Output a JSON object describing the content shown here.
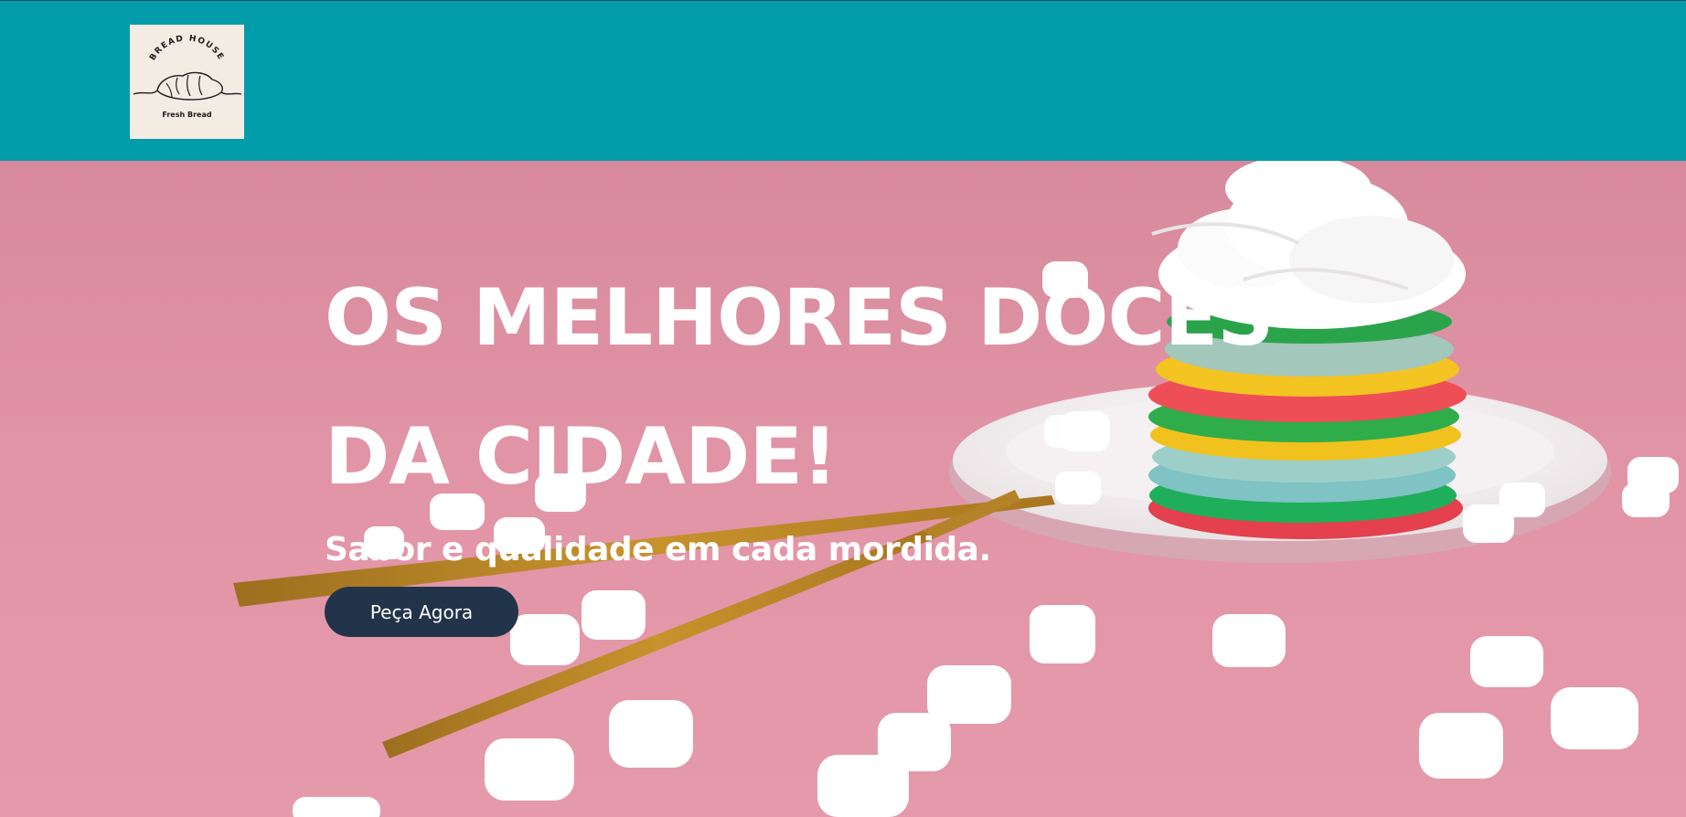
{
  "header": {
    "logo": {
      "brand_top": "BREAD HOUSE",
      "brand_bottom": "Fresh Bread"
    }
  },
  "hero": {
    "title": "OS MELHORES DOCES DA CIDADE!",
    "subtitle": "Sabor e qualidade em cada mordida.",
    "cta_label": "Peça Agora"
  },
  "colors": {
    "header_bg": "#039cab",
    "hero_bg": "#d98da0",
    "button_bg": "#22344a",
    "text": "#ffffff"
  }
}
